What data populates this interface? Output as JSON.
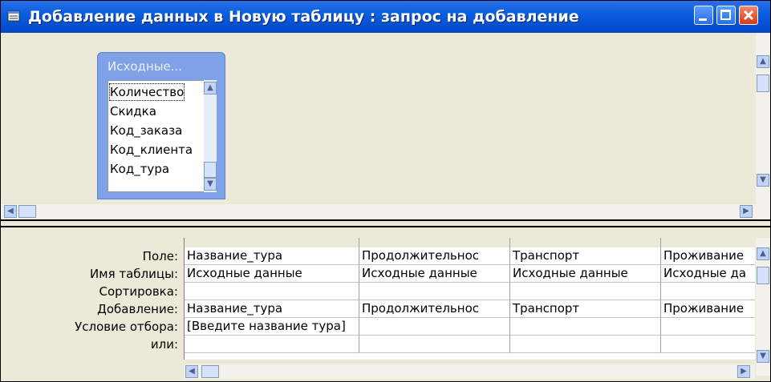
{
  "window": {
    "title": "Добавление данных в Новую таблицу : запрос на добавление"
  },
  "table_box": {
    "title": "Исходные...",
    "fields": [
      "Количество",
      "Скидка",
      "Код_заказа",
      "Код_клиента",
      "Код_тура"
    ],
    "selected_field": "Количество"
  },
  "grid": {
    "row_labels": [
      "Поле:",
      "Имя таблицы:",
      "Сортировка:",
      "Добавление:",
      "Условие отбора:",
      "или:"
    ],
    "columns": [
      {
        "field": "Название_тура",
        "table": "Исходные данные",
        "sort": "",
        "append": "Название_тура",
        "criteria": "[Введите название тура]",
        "or": ""
      },
      {
        "field": "Продолжительнос",
        "table": "Исходные данные",
        "sort": "",
        "append": "Продолжительнос",
        "criteria": "",
        "or": ""
      },
      {
        "field": "Транспорт",
        "table": "Исходные данные",
        "sort": "",
        "append": "Транспорт",
        "criteria": "",
        "or": ""
      },
      {
        "field": "Проживание",
        "table": "Исходные да",
        "sort": "",
        "append": "Проживание",
        "criteria": "",
        "or": ""
      }
    ]
  },
  "colors": {
    "titlebar": "#0a5fe0",
    "tablebox": "#7fa1e6"
  }
}
